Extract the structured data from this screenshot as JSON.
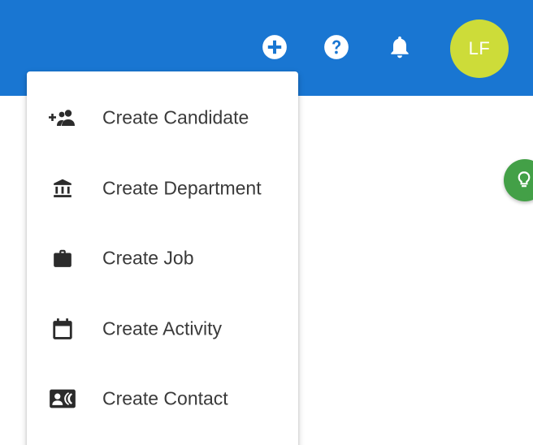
{
  "header": {
    "icons": {
      "add": "add-circle-icon",
      "help": "help-circle-icon",
      "notifications": "bell-icon"
    },
    "avatar": {
      "initials": "LF",
      "color": "#cddc39"
    },
    "background": "#1976d2"
  },
  "fab": {
    "icon": "lightbulb-icon",
    "color": "#43a047"
  },
  "create_menu": {
    "items": [
      {
        "label": "Create Candidate",
        "icon": "add-people-icon"
      },
      {
        "label": "Create Department",
        "icon": "bank-icon"
      },
      {
        "label": "Create Job",
        "icon": "briefcase-icon"
      },
      {
        "label": "Create Activity",
        "icon": "calendar-icon"
      },
      {
        "label": "Create Contact",
        "icon": "contact-card-icon"
      }
    ]
  }
}
